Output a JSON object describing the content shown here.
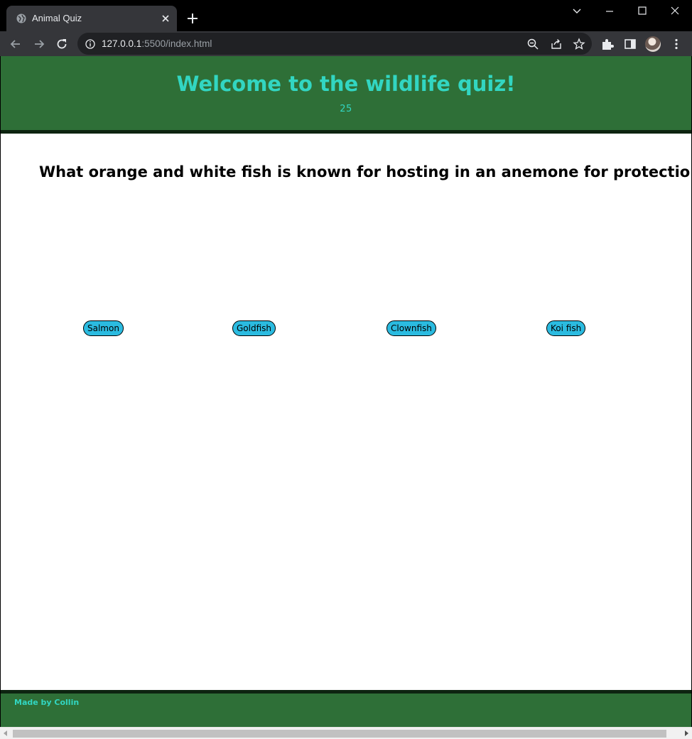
{
  "browser": {
    "tab_title": "Animal Quiz",
    "url_host": "127.0.0.1",
    "url_rest": ":5500/index.html",
    "icons": {
      "favicon": "globe-icon",
      "tab_close": "close-icon",
      "new_tab": "plus-icon",
      "tab_search": "chevron-down-icon",
      "minimize": "minimize-icon",
      "maximize": "maximize-icon",
      "close_window": "close-icon",
      "back": "back-arrow-icon",
      "forward": "forward-arrow-icon",
      "reload": "reload-icon",
      "site_info": "info-icon",
      "zoom": "zoom-out-icon",
      "share": "share-icon",
      "bookmark": "star-icon",
      "extensions": "puzzle-icon",
      "side_panel": "side-panel-icon",
      "menu": "kebab-menu-icon"
    }
  },
  "page": {
    "title": "Welcome to the wildlife quiz!",
    "score": "25",
    "question": "What orange and white fish is known for hosting in an anemone for protection?",
    "answers": [
      "Salmon",
      "Goldfish",
      "Clownfish",
      "Koi fish"
    ],
    "footer": "Made by Collin"
  },
  "colors": {
    "header_bg": "#2e6f37",
    "accent_text": "#32d6c2",
    "button_bg": "#2bbbe0",
    "border_dark": "#0d2410"
  }
}
